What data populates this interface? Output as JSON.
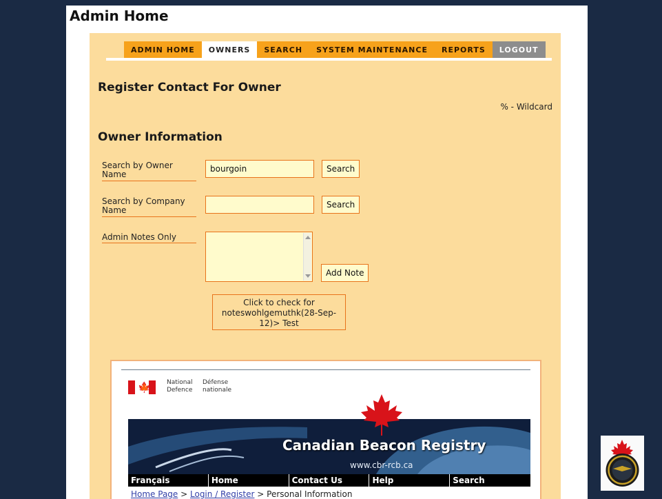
{
  "page": {
    "title": "Admin Home"
  },
  "nav": {
    "tabs": [
      {
        "label": "ADMIN HOME"
      },
      {
        "label": "OWNERS"
      },
      {
        "label": "SEARCH"
      },
      {
        "label": "SYSTEM MAINTENANCE"
      },
      {
        "label": "REPORTS"
      },
      {
        "label": "LOGOUT"
      }
    ],
    "active": "OWNERS"
  },
  "form": {
    "heading": "Register Contact For Owner",
    "wildcard_hint": "% - Wildcard",
    "section_heading": "Owner Information",
    "owner_name": {
      "label": "Search by Owner Name",
      "value": "bourgoin",
      "button": "Search"
    },
    "company_name": {
      "label": "Search by Company Name",
      "value": "",
      "button": "Search"
    },
    "admin_notes": {
      "label": "Admin Notes Only",
      "value": "",
      "button": "Add Note"
    },
    "check_notes": "Click to check for noteswohlgemuthk(28-Sep-12)> Test"
  },
  "embedded_site": {
    "gov_en": "National\nDefence",
    "gov_fr": "Défense\nnationale",
    "banner_title": "Canadian Beacon Registry",
    "banner_url": "www.cbr-rcb.ca",
    "nav": [
      {
        "label": "Français"
      },
      {
        "label": "Home"
      },
      {
        "label": "Contact Us"
      },
      {
        "label": "Help"
      },
      {
        "label": "Search"
      }
    ],
    "breadcrumb": {
      "home": "Home Page",
      "sep1": " > ",
      "login": "Login / Register",
      "sep2": " > ",
      "current": "Personal Information"
    }
  },
  "colors": {
    "background": "#1a2a44",
    "panel": "#fcdc9c",
    "tab": "#f7a21b",
    "accent": "#e8731a",
    "input_bg": "#fffbcc",
    "banner": "#0f1e3b",
    "maple": "#d8131a"
  },
  "icons": {
    "flag": "canada-flag-icon",
    "leaf": "maple-leaf-icon",
    "badge": "air-force-badge-icon"
  }
}
